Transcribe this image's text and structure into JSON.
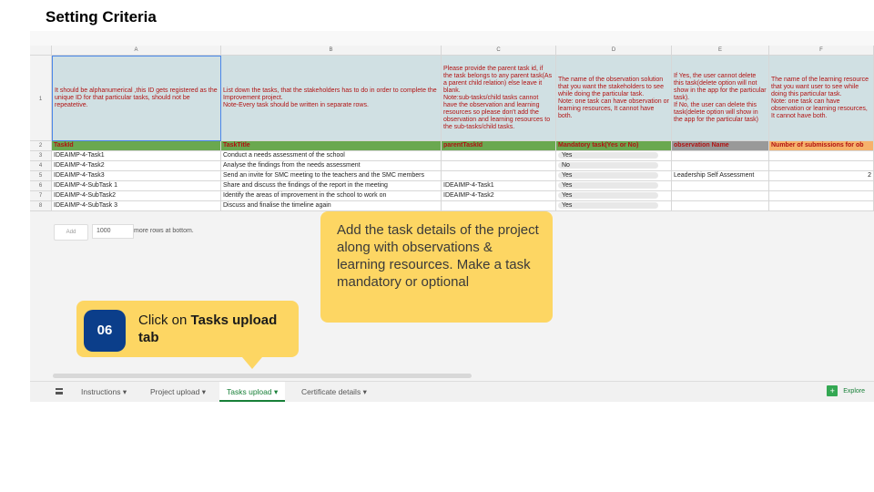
{
  "page_title": "Setting Criteria",
  "columns": [
    "A",
    "B",
    "C",
    "D",
    "E",
    "F"
  ],
  "row_numbers": [
    "1",
    "2",
    "3",
    "4",
    "5",
    "6",
    "7",
    "8"
  ],
  "descriptions": [
    "It should be alphanumerical ,this ID gets registered as the unique ID for that particular tasks, should not be repeatetive.",
    "List down the tasks, that the stakeholders has to do in order to complete the Improvement project.\nNote-Every task should be written in separate rows.",
    "Please provide the parent task id, if the task belongs to any parent task(As a parent child relation) else leave it blank.\nNote:sub-tasks/child tasks cannot have the observation and learning resources so please don't add the observation and learning resources to the sub-tasks/child tasks.",
    "The name of the observation solution that you want the stakeholders to see while doing the particular task.\nNote: one task can have observation or learning resources, It cannot have both.",
    "If Yes, the user cannot delete this task(delete option will not show in the app for the particular task).\nIf No, the user can delete this task(delete option will show in the app for the particular task)",
    "The name of the learning resource that you want user to see while doing this particular task.\nNote: one task can have observation or learning resources, It cannot have both."
  ],
  "headers": [
    "TaskId",
    "TaskTitle",
    "parentTaskId",
    "Mandatory task(Yes or No)",
    "observation Name",
    "Number of submissions for ob"
  ],
  "rows": [
    [
      "IDEAIMP-4-Task1",
      "Conduct a needs assessment of the school",
      "",
      "Yes",
      "",
      ""
    ],
    [
      "IDEAIMP-4-Task2",
      "Analyse the findings from the needs assessment",
      "",
      "No",
      "",
      ""
    ],
    [
      "IDEAIMP-4-Task3",
      "Send an invite for SMC meeting to the teachers and the SMC members",
      "",
      "Yes",
      "Leadership Self Assessment",
      "2"
    ],
    [
      "IDEAIMP-4-SubTask 1",
      "Share and discuss the findings of the report in the meeting",
      "IDEAIMP-4-Task1",
      "Yes",
      "",
      ""
    ],
    [
      "IDEAIMP-4-SubTask2",
      "Identify the areas of improvement in the school to work on",
      "IDEAIMP-4-Task2",
      "Yes",
      "",
      ""
    ],
    [
      "IDEAIMP-4-SubTask 3",
      "Discuss and finalise the timeline again",
      "",
      "Yes",
      "",
      ""
    ]
  ],
  "add_rows": {
    "button": "Add",
    "count": "1000",
    "text": "more rows at bottom."
  },
  "tabs": [
    {
      "label": "Instructions",
      "arrow": "▾"
    },
    {
      "label": "Project upload",
      "arrow": "▾"
    },
    {
      "label": "Tasks upload",
      "arrow": "▾"
    },
    {
      "label": "Certificate details",
      "arrow": "▾"
    }
  ],
  "explore_label": "Explore",
  "callout_main": "Add the task details of the project along with observations & learning resources. Make a task mandatory or optional",
  "callout_step": {
    "number": "06",
    "text_prefix": "Click on ",
    "text_bold": "Tasks upload tab"
  },
  "colors": {
    "accent_green": "#188038",
    "callout_yellow": "#fdd663",
    "step_blue": "#0b3e8a",
    "header_green": "#6aa84f",
    "description_blue": "#d0e0e3",
    "text_red": "#b11313"
  }
}
